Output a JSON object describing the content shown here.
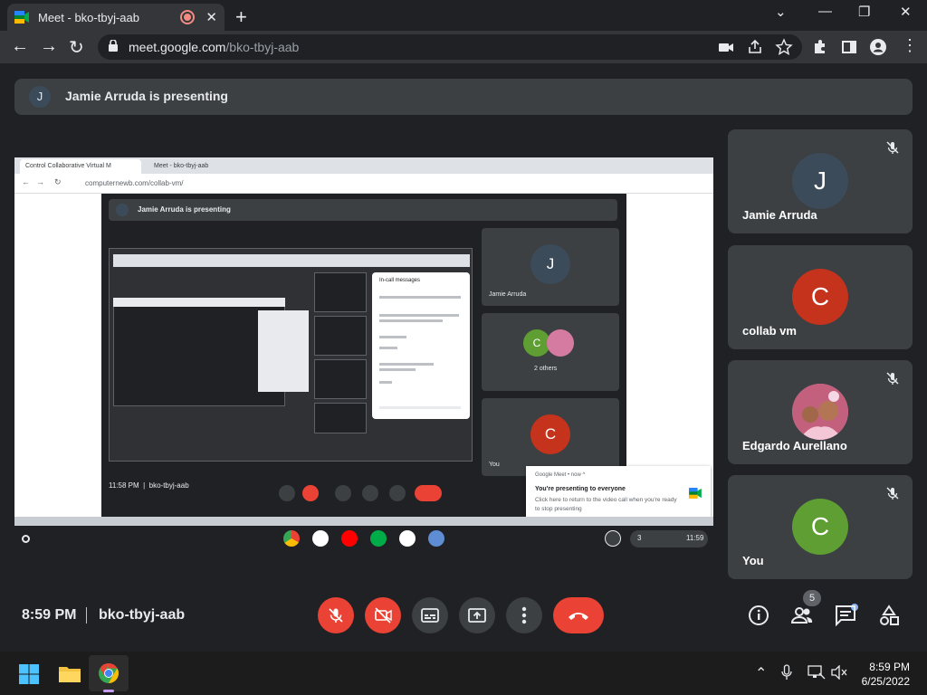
{
  "browser": {
    "tab_title": "Meet - bko-tbyj-aab",
    "new_tab_icon": "plus-icon",
    "url_host": "meet.google.com",
    "url_path": "/bko-tbyj-aab"
  },
  "banner": {
    "avatar_letter": "J",
    "text": "Jamie Arruda is presenting"
  },
  "shared_screen": {
    "tab1": "Control Collaborative Virtual M",
    "tab2": "Meet - bko-tbyj-aab",
    "url": "computernewb.com/collab-vm/",
    "banner_text": "Jamie Arruda is presenting",
    "chat_title": "In-call messages",
    "tiles": [
      {
        "letter": "J",
        "name": "Jamie Arruda",
        "color": "#3c4b5a"
      },
      {
        "letter": "C",
        "name": "2 others",
        "color": "#5e9e32"
      },
      {
        "letter": "C",
        "name": "You",
        "color": "#c5331c"
      }
    ],
    "bottom_time": "11:58 PM",
    "bottom_code": "bko-tbyj-aab",
    "notification": {
      "header": "Google Meet • now ^",
      "title": "You're presenting to everyone",
      "body": "Click here to return to the video call when you're ready to stop presenting"
    },
    "shelf_clock": "11:59",
    "shelf_badge": "3"
  },
  "participants": [
    {
      "letter": "J",
      "name": "Jamie Arruda",
      "color": "#3c4b5a",
      "muted": true
    },
    {
      "letter": "C",
      "name": "collab vm",
      "color": "#c5331c",
      "muted": false
    },
    {
      "letter": "",
      "name": "Edgardo Aurellano",
      "color": "#d57aa0",
      "muted": true
    },
    {
      "letter": "C",
      "name": "You",
      "color": "#5e9e32",
      "muted": true
    }
  ],
  "meeting": {
    "time": "8:59 PM",
    "code": "bko-tbyj-aab",
    "people_count": "5"
  },
  "taskbar": {
    "time": "8:59 PM",
    "date": "6/25/2022"
  },
  "colors": {
    "accent_red": "#ea4335",
    "bg": "#202124",
    "tile_bg": "#3c4043"
  }
}
